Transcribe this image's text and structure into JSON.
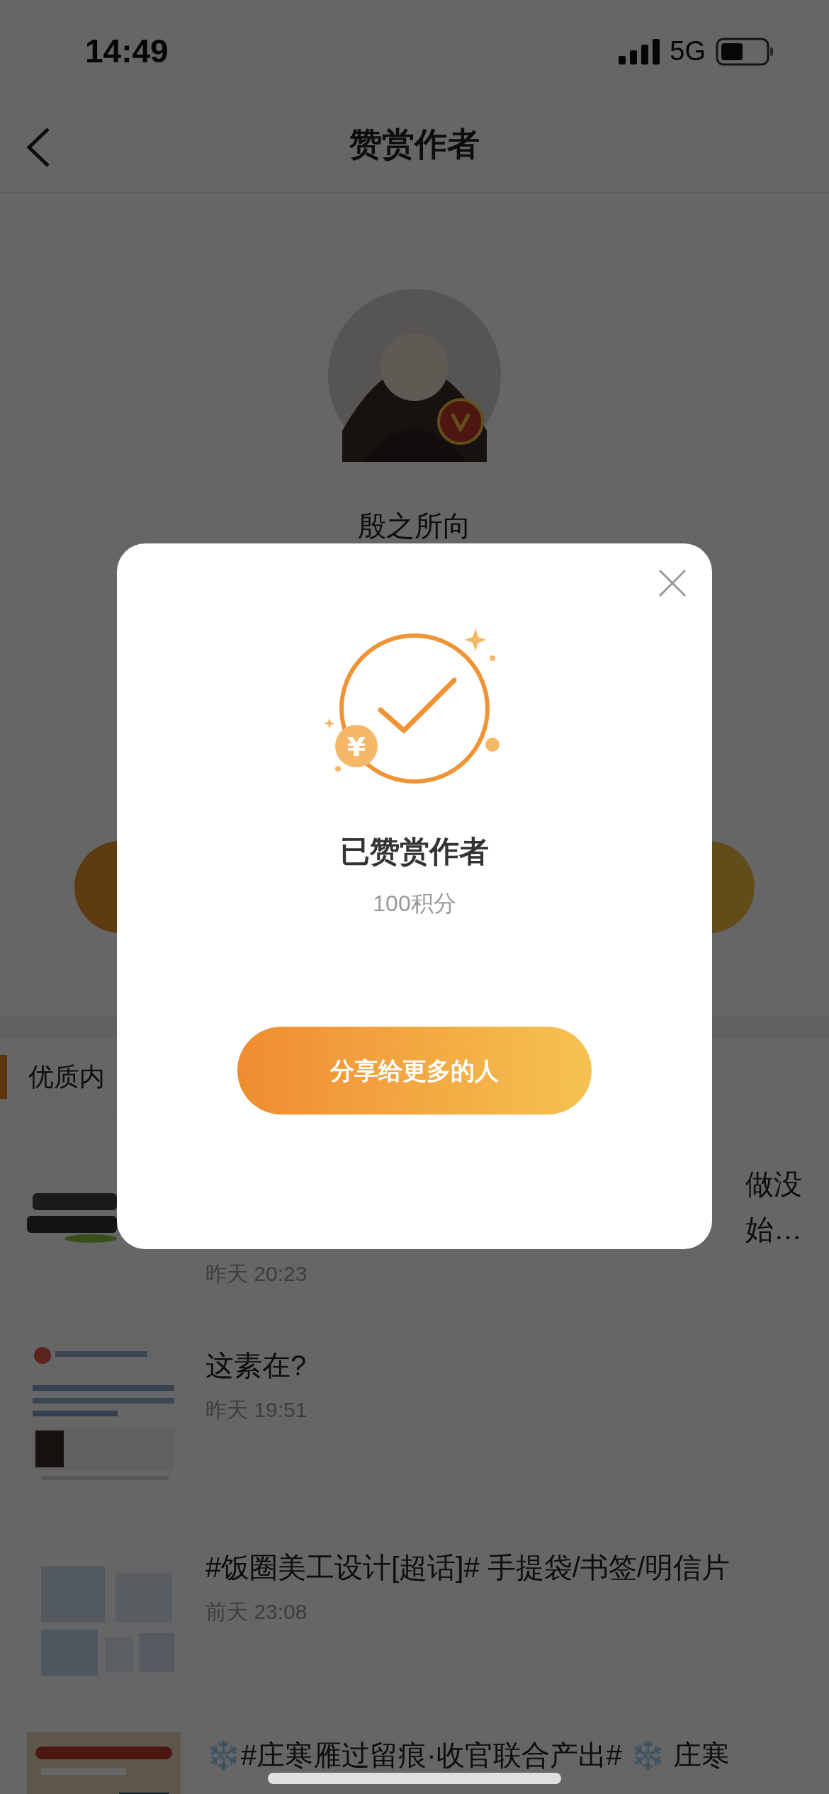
{
  "status_bar": {
    "time": "14:49",
    "network": "5G"
  },
  "nav": {
    "title": "赞赏作者"
  },
  "author": {
    "name": "殷之所向",
    "verified": true
  },
  "section": {
    "title": "优质内"
  },
  "posts": [
    {
      "title_lines": [
        "做没",
        "始…"
      ],
      "time": "昨天 20:23"
    },
    {
      "title_lines": [
        "这素在?"
      ],
      "time": "昨天 19:51"
    },
    {
      "title_lines": [
        "#饭圈美工设计[超话]# 手提袋/书签/明信片"
      ],
      "time": "前天 23:08"
    },
    {
      "title_lines": [
        "❄️#庄寒雁过留痕·收官联合产出# ❄️ 庄寒"
      ]
    }
  ],
  "dialog": {
    "coin_symbol": "¥",
    "title": "已赞赏作者",
    "points": "100积分",
    "share_button": "分享给更多的人"
  }
}
